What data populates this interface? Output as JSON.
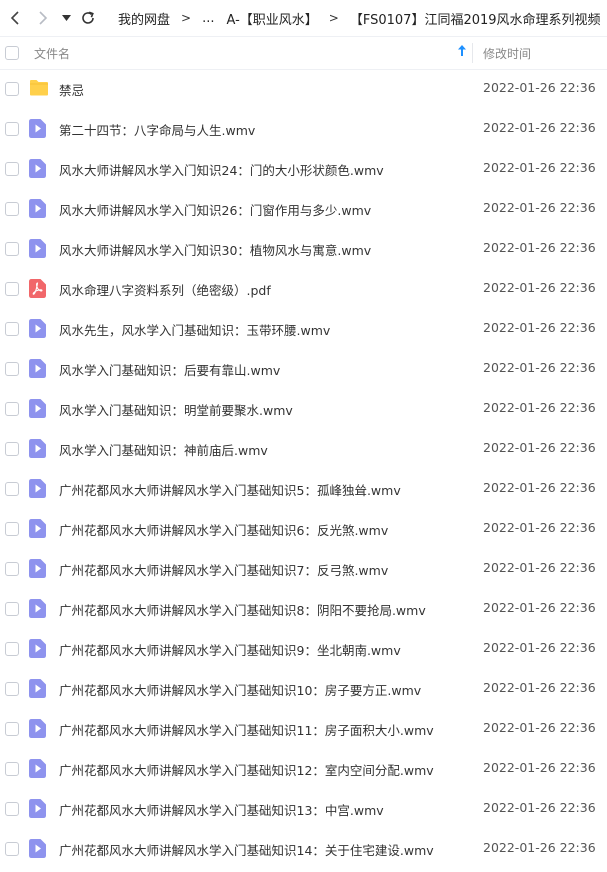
{
  "breadcrumb": {
    "separator": ">",
    "items": [
      "我的网盘",
      "...",
      "A-【职业风水】",
      "【FS0107】江同福2019风水命理系列视频"
    ]
  },
  "header": {
    "name_label": "文件名",
    "time_label": "修改时间"
  },
  "colors": {
    "video_icon": "#8e93ee",
    "pdf_icon": "#f1676a",
    "folder_icon": "#ffd04b",
    "sort_arrow": "#1e90ff"
  },
  "files": [
    {
      "name": "禁忌",
      "time": "2022-01-26 22:36",
      "icon": "folder-icon"
    },
    {
      "name": "第二十四节：八字命局与人生.wmv",
      "time": "2022-01-26 22:36",
      "icon": "video-file-icon"
    },
    {
      "name": "风水大师讲解风水学入门知识24：门的大小形状颜色.wmv",
      "time": "2022-01-26 22:36",
      "icon": "video-file-icon"
    },
    {
      "name": "风水大师讲解风水学入门知识26：门窗作用与多少.wmv",
      "time": "2022-01-26 22:36",
      "icon": "video-file-icon"
    },
    {
      "name": "风水大师讲解风水学入门知识30：植物风水与寓意.wmv",
      "time": "2022-01-26 22:36",
      "icon": "video-file-icon"
    },
    {
      "name": "风水命理八字资料系列（绝密级）.pdf",
      "time": "2022-01-26 22:36",
      "icon": "pdf-file-icon"
    },
    {
      "name": "风水先生，风水学入门基础知识：玉带环腰.wmv",
      "time": "2022-01-26 22:36",
      "icon": "video-file-icon"
    },
    {
      "name": "风水学入门基础知识：后要有靠山.wmv",
      "time": "2022-01-26 22:36",
      "icon": "video-file-icon"
    },
    {
      "name": "风水学入门基础知识：明堂前要聚水.wmv",
      "time": "2022-01-26 22:36",
      "icon": "video-file-icon"
    },
    {
      "name": "风水学入门基础知识：神前庙后.wmv",
      "time": "2022-01-26 22:36",
      "icon": "video-file-icon"
    },
    {
      "name": "广州花都风水大师讲解风水学入门基础知识5：孤峰独耸.wmv",
      "time": "2022-01-26 22:36",
      "icon": "video-file-icon"
    },
    {
      "name": "广州花都风水大师讲解风水学入门基础知识6：反光煞.wmv",
      "time": "2022-01-26 22:36",
      "icon": "video-file-icon"
    },
    {
      "name": "广州花都风水大师讲解风水学入门基础知识7：反弓煞.wmv",
      "time": "2022-01-26 22:36",
      "icon": "video-file-icon"
    },
    {
      "name": "广州花都风水大师讲解风水学入门基础知识8：阴阳不要抢局.wmv",
      "time": "2022-01-26 22:36",
      "icon": "video-file-icon"
    },
    {
      "name": "广州花都风水大师讲解风水学入门基础知识9：坐北朝南.wmv",
      "time": "2022-01-26 22:36",
      "icon": "video-file-icon"
    },
    {
      "name": "广州花都风水大师讲解风水学入门基础知识10：房子要方正.wmv",
      "time": "2022-01-26 22:36",
      "icon": "video-file-icon"
    },
    {
      "name": "广州花都风水大师讲解风水学入门基础知识11：房子面积大小.wmv",
      "time": "2022-01-26 22:36",
      "icon": "video-file-icon"
    },
    {
      "name": "广州花都风水大师讲解风水学入门基础知识12：室内空间分配.wmv",
      "time": "2022-01-26 22:36",
      "icon": "video-file-icon"
    },
    {
      "name": "广州花都风水大师讲解风水学入门基础知识13：中宫.wmv",
      "time": "2022-01-26 22:36",
      "icon": "video-file-icon"
    },
    {
      "name": "广州花都风水大师讲解风水学入门基础知识14：关于住宅建设.wmv",
      "time": "2022-01-26 22:36",
      "icon": "video-file-icon"
    }
  ]
}
